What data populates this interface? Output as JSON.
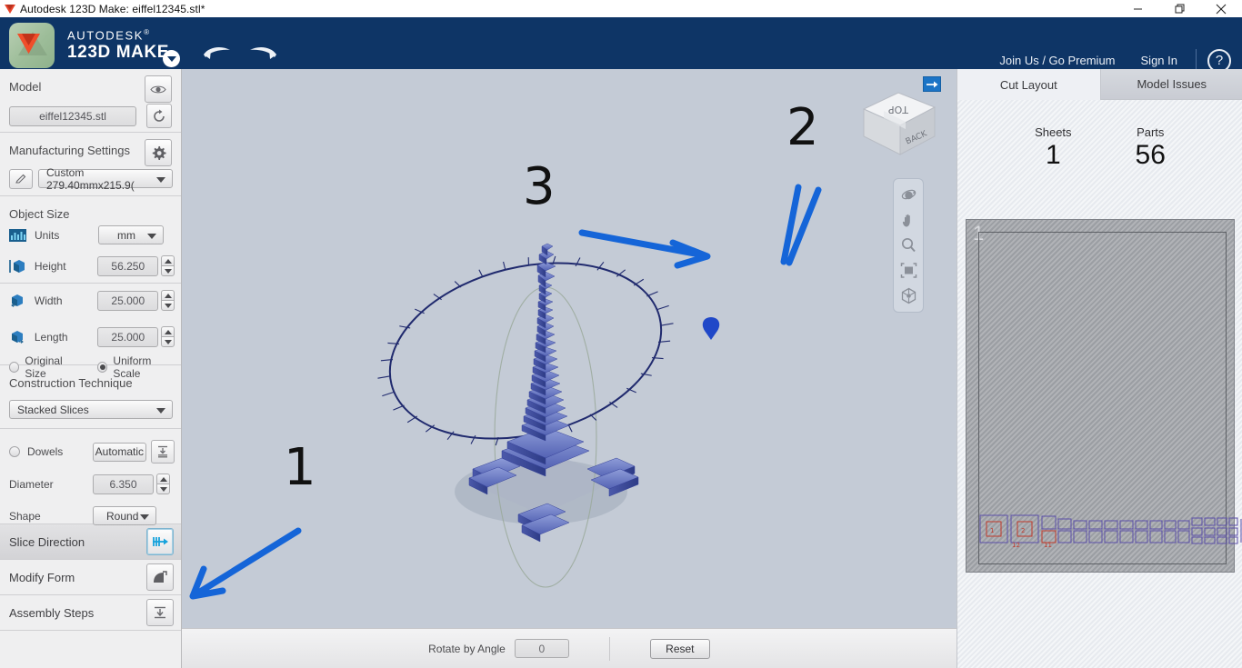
{
  "window": {
    "title": "Autodesk 123D Make: eiffel12345.stl*",
    "controls": {
      "minimize": "—",
      "restore": "❐",
      "close": "✕"
    }
  },
  "header": {
    "brand_line1": "AUTODESK",
    "brand_line2": "123D MAKE",
    "brand_sup1": "®",
    "brand_sup2": "®",
    "join_label": "Join Us / Go Premium",
    "signin_label": "Sign In",
    "help_label": "?",
    "accent_color": "#0e3566"
  },
  "sidebar": {
    "model": {
      "title": "Model",
      "file_name": "eiffel12345.stl"
    },
    "manufacturing": {
      "title": "Manufacturing Settings",
      "preset": "Custom 279.40mmx215.9("
    },
    "object_size": {
      "title": "Object Size",
      "units_label": "Units",
      "units_value": "mm",
      "height_label": "Height",
      "height_value": "56.250",
      "width_label": "Width",
      "width_value": "25.000",
      "length_label": "Length",
      "length_value": "25.000",
      "original_size_label": "Original Size",
      "uniform_scale_label": "Uniform Scale",
      "scale_mode": "Uniform Scale"
    },
    "construction": {
      "title": "Construction Technique",
      "technique": "Stacked Slices"
    },
    "dowels": {
      "dowels_label": "Dowels",
      "automatic_label": "Automatic",
      "diameter_label": "Diameter",
      "diameter_value": "6.350",
      "shape_label": "Shape",
      "shape_value": "Round"
    },
    "nav": [
      {
        "label": "Slice Direction",
        "active": true
      },
      {
        "label": "Modify Form",
        "active": false
      },
      {
        "label": "Assembly Steps",
        "active": false
      }
    ]
  },
  "viewport": {
    "viewcube_top": "TOP",
    "viewcube_back": "BACK",
    "background_color": "#c4cbd6",
    "tools": [
      "orbit-icon",
      "pan-icon",
      "zoom-icon",
      "fit-to-window-icon",
      "view-cube-icon"
    ],
    "annotations": [
      {
        "id": "1",
        "label": "1"
      },
      {
        "id": "2",
        "label": "2"
      },
      {
        "id": "3",
        "label": "3"
      }
    ],
    "annotation_color": "#1565d8"
  },
  "bottom_bar": {
    "rotate_label": "Rotate by  Angle",
    "rotate_value": "0",
    "reset_label": "Reset"
  },
  "right_panel": {
    "tabs": [
      {
        "label": "Cut Layout",
        "active": true
      },
      {
        "label": "Model Issues",
        "active": false
      }
    ],
    "stats": [
      {
        "label": "Sheets",
        "value": "1"
      },
      {
        "label": "Parts",
        "value": "56"
      }
    ],
    "sheet_number": "1"
  }
}
